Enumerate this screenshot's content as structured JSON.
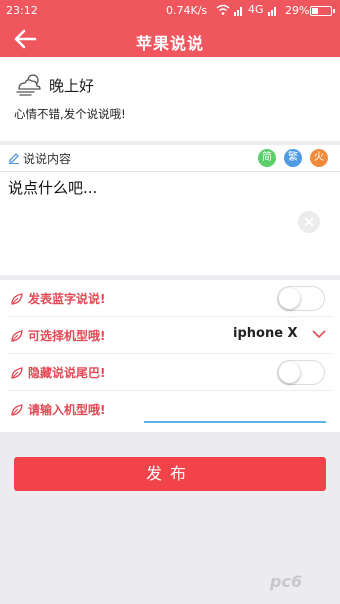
{
  "status_bar": {
    "time": "23:12",
    "network_speed": "0.74K/s",
    "signal_label": "4G",
    "battery": "29%",
    "battery_level": 0.29
  },
  "header": {
    "title": "苹果说说",
    "back_icon": "arrow-left-icon",
    "color": "#f0565e"
  },
  "greeting": {
    "weather_icon": "cloud-wind-icon",
    "title": "晚上好",
    "subtitle": "心情不错,发个说说哦!"
  },
  "post_content": {
    "label": "说说内容",
    "pen_icon": "pen-icon",
    "badges": [
      "简",
      "繁",
      "火"
    ],
    "text": "说点什么吧...",
    "clear_icon": "clear-icon"
  },
  "options": {
    "blue_text": {
      "label": "发表蓝字说说!",
      "enabled": false
    },
    "model_select": {
      "label": "可选择机型哦!",
      "value": "iphone X"
    },
    "hide_tail": {
      "label": "隐藏说说尾巴!",
      "enabled": false
    },
    "model_input": {
      "label": "请输入机型哦!",
      "value": ""
    },
    "leaf_icon": "leaf-icon"
  },
  "actions": {
    "publish_label": "发布",
    "publish_color": "#f2434b"
  },
  "watermark": "pc6"
}
